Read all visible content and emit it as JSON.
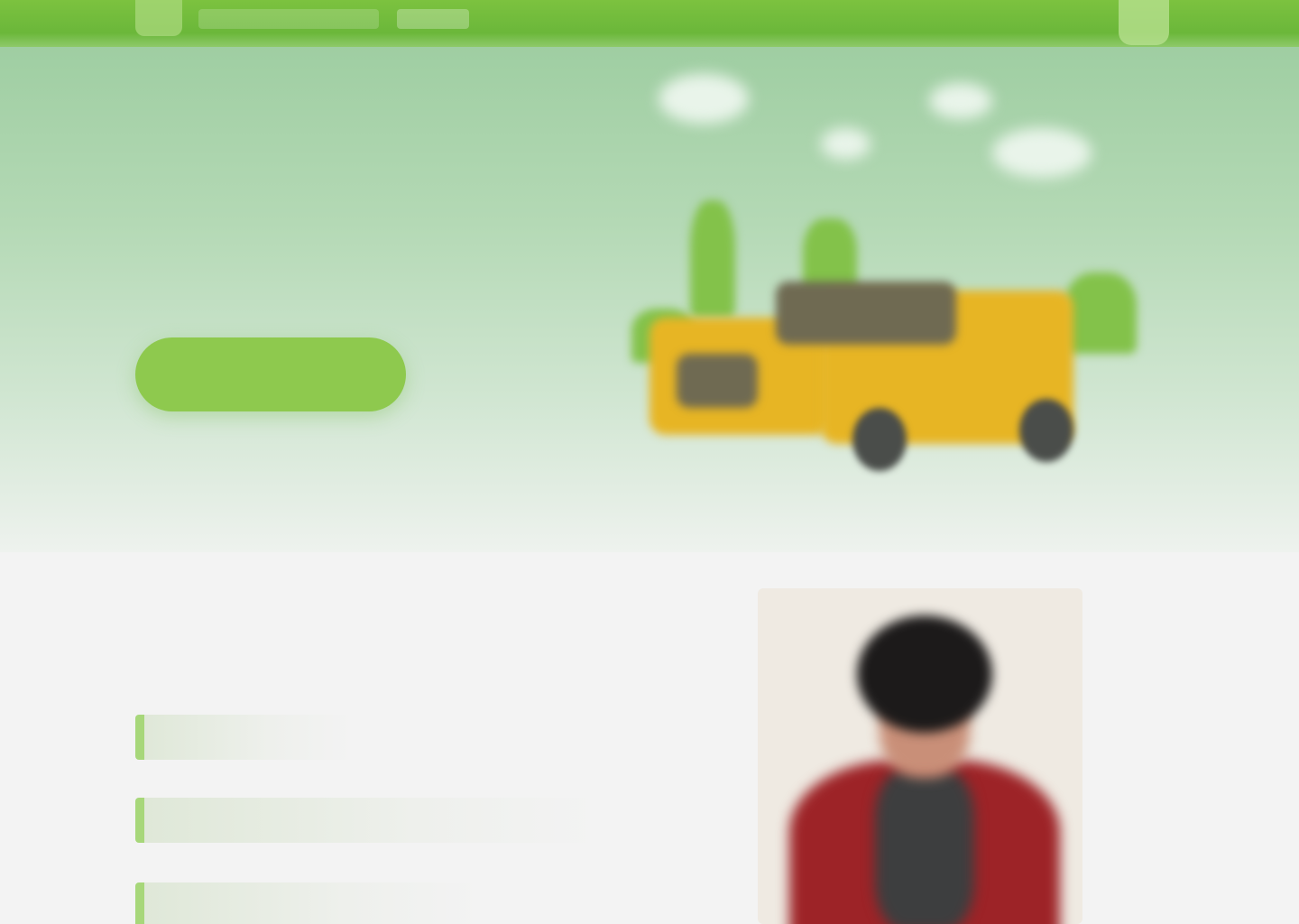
{
  "header": {
    "logo": "logo-icon",
    "nav_items": [
      "",
      ""
    ],
    "account": "account-icon",
    "accent_color": "#6bb73a"
  },
  "hero": {
    "headline": "",
    "cta_label": "",
    "illustration": "excavator-illustration",
    "cta_color": "#8ec94e"
  },
  "section": {
    "heading": "",
    "features": [
      "",
      "",
      ""
    ],
    "portrait": "person-portrait"
  }
}
